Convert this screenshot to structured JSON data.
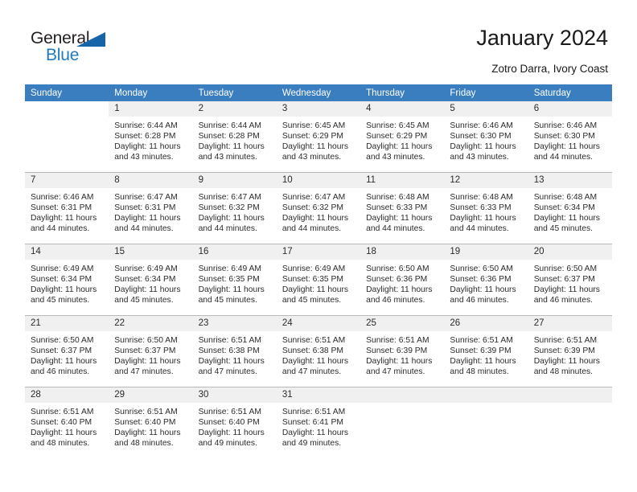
{
  "brand": {
    "name_dark": "General",
    "name_blue": "Blue",
    "accent_color": "#1565a8",
    "blue_text_color": "#1f7ac4"
  },
  "header": {
    "title": "January 2024",
    "subtitle": "Zotro Darra, Ivory Coast",
    "header_bg_color": "#3a7ebf",
    "daynum_bg_color": "#f0f0f0"
  },
  "weekdays": [
    "Sunday",
    "Monday",
    "Tuesday",
    "Wednesday",
    "Thursday",
    "Friday",
    "Saturday"
  ],
  "weeks": [
    [
      {
        "day": "",
        "blank": true
      },
      {
        "day": "1",
        "sunrise": "Sunrise: 6:44 AM",
        "sunset": "Sunset: 6:28 PM",
        "daylight1": "Daylight: 11 hours",
        "daylight2": "and 43 minutes."
      },
      {
        "day": "2",
        "sunrise": "Sunrise: 6:44 AM",
        "sunset": "Sunset: 6:28 PM",
        "daylight1": "Daylight: 11 hours",
        "daylight2": "and 43 minutes."
      },
      {
        "day": "3",
        "sunrise": "Sunrise: 6:45 AM",
        "sunset": "Sunset: 6:29 PM",
        "daylight1": "Daylight: 11 hours",
        "daylight2": "and 43 minutes."
      },
      {
        "day": "4",
        "sunrise": "Sunrise: 6:45 AM",
        "sunset": "Sunset: 6:29 PM",
        "daylight1": "Daylight: 11 hours",
        "daylight2": "and 43 minutes."
      },
      {
        "day": "5",
        "sunrise": "Sunrise: 6:46 AM",
        "sunset": "Sunset: 6:30 PM",
        "daylight1": "Daylight: 11 hours",
        "daylight2": "and 43 minutes."
      },
      {
        "day": "6",
        "sunrise": "Sunrise: 6:46 AM",
        "sunset": "Sunset: 6:30 PM",
        "daylight1": "Daylight: 11 hours",
        "daylight2": "and 44 minutes."
      }
    ],
    [
      {
        "day": "7",
        "sunrise": "Sunrise: 6:46 AM",
        "sunset": "Sunset: 6:31 PM",
        "daylight1": "Daylight: 11 hours",
        "daylight2": "and 44 minutes."
      },
      {
        "day": "8",
        "sunrise": "Sunrise: 6:47 AM",
        "sunset": "Sunset: 6:31 PM",
        "daylight1": "Daylight: 11 hours",
        "daylight2": "and 44 minutes."
      },
      {
        "day": "9",
        "sunrise": "Sunrise: 6:47 AM",
        "sunset": "Sunset: 6:32 PM",
        "daylight1": "Daylight: 11 hours",
        "daylight2": "and 44 minutes."
      },
      {
        "day": "10",
        "sunrise": "Sunrise: 6:47 AM",
        "sunset": "Sunset: 6:32 PM",
        "daylight1": "Daylight: 11 hours",
        "daylight2": "and 44 minutes."
      },
      {
        "day": "11",
        "sunrise": "Sunrise: 6:48 AM",
        "sunset": "Sunset: 6:33 PM",
        "daylight1": "Daylight: 11 hours",
        "daylight2": "and 44 minutes."
      },
      {
        "day": "12",
        "sunrise": "Sunrise: 6:48 AM",
        "sunset": "Sunset: 6:33 PM",
        "daylight1": "Daylight: 11 hours",
        "daylight2": "and 44 minutes."
      },
      {
        "day": "13",
        "sunrise": "Sunrise: 6:48 AM",
        "sunset": "Sunset: 6:34 PM",
        "daylight1": "Daylight: 11 hours",
        "daylight2": "and 45 minutes."
      }
    ],
    [
      {
        "day": "14",
        "sunrise": "Sunrise: 6:49 AM",
        "sunset": "Sunset: 6:34 PM",
        "daylight1": "Daylight: 11 hours",
        "daylight2": "and 45 minutes."
      },
      {
        "day": "15",
        "sunrise": "Sunrise: 6:49 AM",
        "sunset": "Sunset: 6:34 PM",
        "daylight1": "Daylight: 11 hours",
        "daylight2": "and 45 minutes."
      },
      {
        "day": "16",
        "sunrise": "Sunrise: 6:49 AM",
        "sunset": "Sunset: 6:35 PM",
        "daylight1": "Daylight: 11 hours",
        "daylight2": "and 45 minutes."
      },
      {
        "day": "17",
        "sunrise": "Sunrise: 6:49 AM",
        "sunset": "Sunset: 6:35 PM",
        "daylight1": "Daylight: 11 hours",
        "daylight2": "and 45 minutes."
      },
      {
        "day": "18",
        "sunrise": "Sunrise: 6:50 AM",
        "sunset": "Sunset: 6:36 PM",
        "daylight1": "Daylight: 11 hours",
        "daylight2": "and 46 minutes."
      },
      {
        "day": "19",
        "sunrise": "Sunrise: 6:50 AM",
        "sunset": "Sunset: 6:36 PM",
        "daylight1": "Daylight: 11 hours",
        "daylight2": "and 46 minutes."
      },
      {
        "day": "20",
        "sunrise": "Sunrise: 6:50 AM",
        "sunset": "Sunset: 6:37 PM",
        "daylight1": "Daylight: 11 hours",
        "daylight2": "and 46 minutes."
      }
    ],
    [
      {
        "day": "21",
        "sunrise": "Sunrise: 6:50 AM",
        "sunset": "Sunset: 6:37 PM",
        "daylight1": "Daylight: 11 hours",
        "daylight2": "and 46 minutes."
      },
      {
        "day": "22",
        "sunrise": "Sunrise: 6:50 AM",
        "sunset": "Sunset: 6:37 PM",
        "daylight1": "Daylight: 11 hours",
        "daylight2": "and 47 minutes."
      },
      {
        "day": "23",
        "sunrise": "Sunrise: 6:51 AM",
        "sunset": "Sunset: 6:38 PM",
        "daylight1": "Daylight: 11 hours",
        "daylight2": "and 47 minutes."
      },
      {
        "day": "24",
        "sunrise": "Sunrise: 6:51 AM",
        "sunset": "Sunset: 6:38 PM",
        "daylight1": "Daylight: 11 hours",
        "daylight2": "and 47 minutes."
      },
      {
        "day": "25",
        "sunrise": "Sunrise: 6:51 AM",
        "sunset": "Sunset: 6:39 PM",
        "daylight1": "Daylight: 11 hours",
        "daylight2": "and 47 minutes."
      },
      {
        "day": "26",
        "sunrise": "Sunrise: 6:51 AM",
        "sunset": "Sunset: 6:39 PM",
        "daylight1": "Daylight: 11 hours",
        "daylight2": "and 48 minutes."
      },
      {
        "day": "27",
        "sunrise": "Sunrise: 6:51 AM",
        "sunset": "Sunset: 6:39 PM",
        "daylight1": "Daylight: 11 hours",
        "daylight2": "and 48 minutes."
      }
    ],
    [
      {
        "day": "28",
        "sunrise": "Sunrise: 6:51 AM",
        "sunset": "Sunset: 6:40 PM",
        "daylight1": "Daylight: 11 hours",
        "daylight2": "and 48 minutes."
      },
      {
        "day": "29",
        "sunrise": "Sunrise: 6:51 AM",
        "sunset": "Sunset: 6:40 PM",
        "daylight1": "Daylight: 11 hours",
        "daylight2": "and 48 minutes."
      },
      {
        "day": "30",
        "sunrise": "Sunrise: 6:51 AM",
        "sunset": "Sunset: 6:40 PM",
        "daylight1": "Daylight: 11 hours",
        "daylight2": "and 49 minutes."
      },
      {
        "day": "31",
        "sunrise": "Sunrise: 6:51 AM",
        "sunset": "Sunset: 6:41 PM",
        "daylight1": "Daylight: 11 hours",
        "daylight2": "and 49 minutes."
      },
      {
        "day": "",
        "empty": true
      },
      {
        "day": "",
        "empty": true
      },
      {
        "day": "",
        "empty": true
      }
    ]
  ]
}
